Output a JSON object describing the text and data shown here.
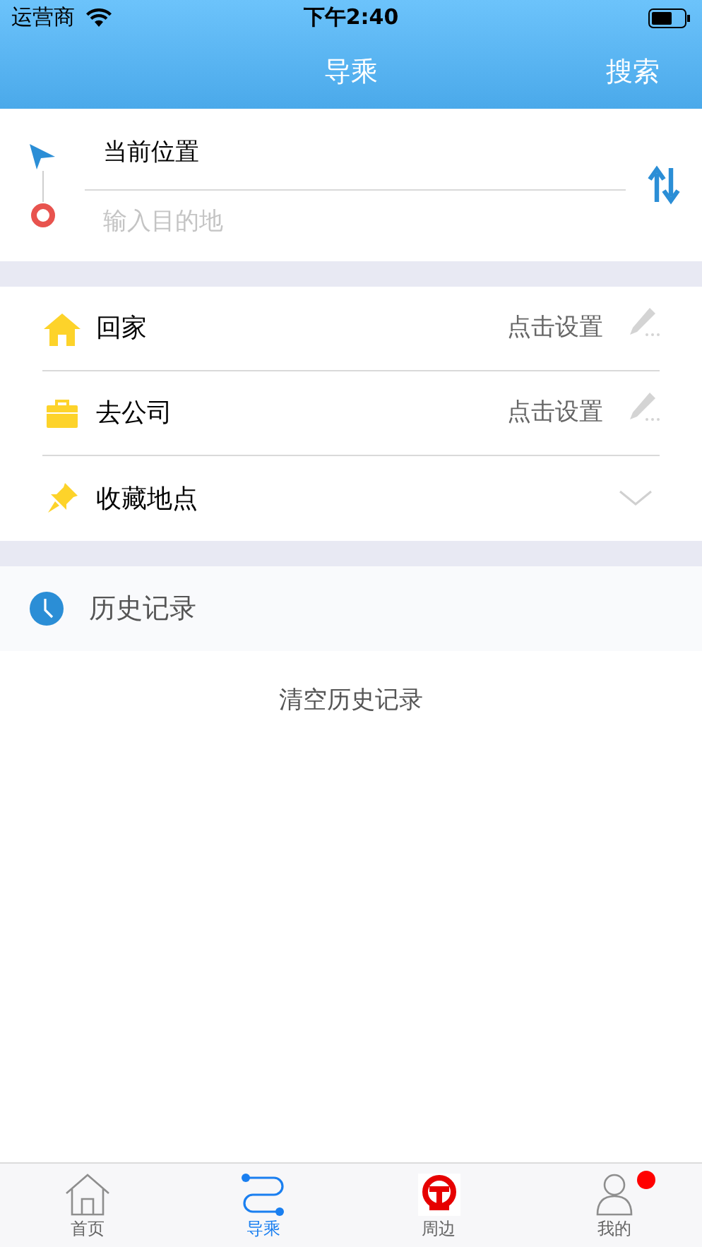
{
  "status_bar": {
    "carrier": "运营商",
    "time": "下午2:40"
  },
  "nav": {
    "title": "导乘",
    "action": "搜索"
  },
  "route": {
    "origin": "当前位置",
    "destination_placeholder": "输入目的地"
  },
  "shortcuts": [
    {
      "kind": "home",
      "label": "回家",
      "action": "点击设置"
    },
    {
      "kind": "work",
      "label": "去公司",
      "action": "点击设置"
    },
    {
      "kind": "favorites",
      "label": "收藏地点"
    }
  ],
  "history": {
    "title": "历史记录",
    "clear": "清空历史记录"
  },
  "tabs": [
    {
      "kind": "home",
      "label": "首页",
      "selected": false,
      "badge": false
    },
    {
      "kind": "route",
      "label": "导乘",
      "selected": true,
      "badge": false
    },
    {
      "kind": "rail",
      "label": "周边",
      "selected": false,
      "badge": false
    },
    {
      "kind": "profile",
      "label": "我的",
      "selected": false,
      "badge": true
    }
  ]
}
